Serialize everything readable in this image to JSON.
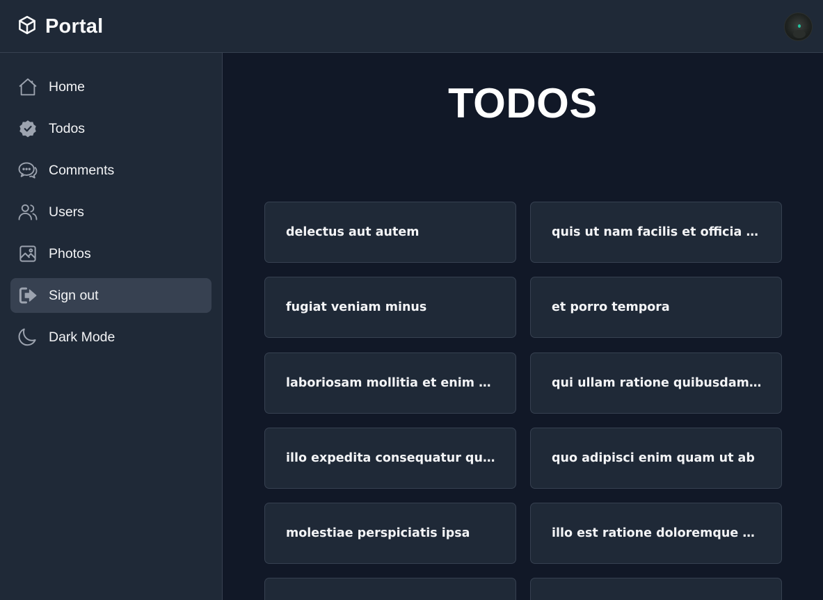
{
  "header": {
    "brand": "Portal"
  },
  "sidebar": {
    "items": [
      {
        "label": "Home",
        "icon": "home-icon",
        "active": false
      },
      {
        "label": "Todos",
        "icon": "check-badge-icon",
        "active": false
      },
      {
        "label": "Comments",
        "icon": "chat-bubbles-icon",
        "active": false
      },
      {
        "label": "Users",
        "icon": "users-icon",
        "active": false
      },
      {
        "label": "Photos",
        "icon": "photo-icon",
        "active": false
      },
      {
        "label": "Sign out",
        "icon": "sign-out-icon",
        "active": true
      },
      {
        "label": "Dark Mode",
        "icon": "moon-icon",
        "active": false
      }
    ]
  },
  "main": {
    "title": "TODOS",
    "todos": [
      "delectus aut autem",
      "quis ut nam facilis et officia qui",
      "fugiat veniam minus",
      "et porro tempora",
      "laboriosam mollitia et enim quasi adipisci quia provident illum",
      "qui ullam ratione quibusdam voluptatem quia omnis",
      "illo expedita consequatur quia in",
      "quo adipisci enim quam ut ab",
      "molestiae perspiciatis ipsa",
      "illo est ratione doloremque quia maiores aut",
      "",
      ""
    ]
  },
  "colors": {
    "page_bg": "#111827",
    "panel_bg": "#1f2937",
    "border": "#374151",
    "active_bg": "#374151",
    "icon": "#9ca3af"
  }
}
